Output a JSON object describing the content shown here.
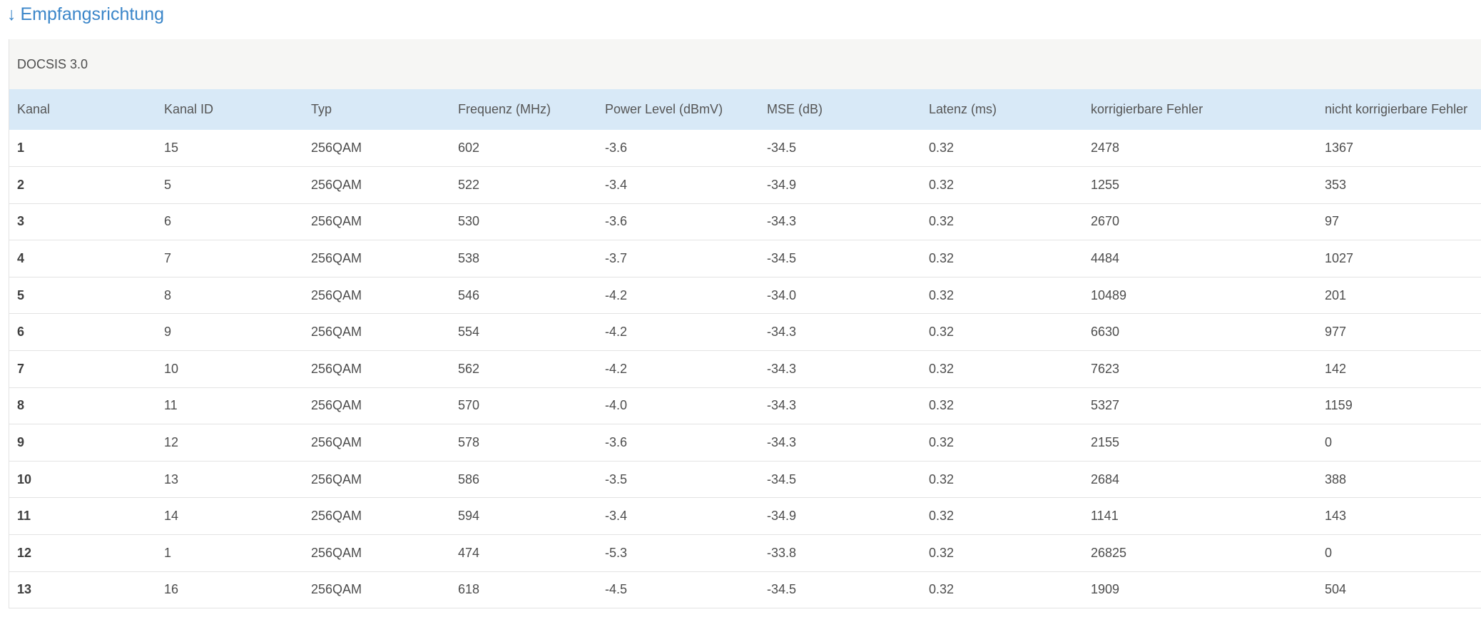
{
  "heading": {
    "arrow": "↓",
    "label": "Empfangsrichtung"
  },
  "panel": {
    "title": "DOCSIS 3.0"
  },
  "table": {
    "columns": [
      "Kanal",
      "Kanal ID",
      "Typ",
      "Frequenz (MHz)",
      "Power Level (dBmV)",
      "MSE (dB)",
      "Latenz (ms)",
      "korrigierbare Fehler",
      "nicht korrigierbare Fehler"
    ],
    "rows": [
      [
        "1",
        "15",
        "256QAM",
        "602",
        "-3.6",
        "-34.5",
        "0.32",
        "2478",
        "1367"
      ],
      [
        "2",
        "5",
        "256QAM",
        "522",
        "-3.4",
        "-34.9",
        "0.32",
        "1255",
        "353"
      ],
      [
        "3",
        "6",
        "256QAM",
        "530",
        "-3.6",
        "-34.3",
        "0.32",
        "2670",
        "97"
      ],
      [
        "4",
        "7",
        "256QAM",
        "538",
        "-3.7",
        "-34.5",
        "0.32",
        "4484",
        "1027"
      ],
      [
        "5",
        "8",
        "256QAM",
        "546",
        "-4.2",
        "-34.0",
        "0.32",
        "10489",
        "201"
      ],
      [
        "6",
        "9",
        "256QAM",
        "554",
        "-4.2",
        "-34.3",
        "0.32",
        "6630",
        "977"
      ],
      [
        "7",
        "10",
        "256QAM",
        "562",
        "-4.2",
        "-34.3",
        "0.32",
        "7623",
        "142"
      ],
      [
        "8",
        "11",
        "256QAM",
        "570",
        "-4.0",
        "-34.3",
        "0.32",
        "5327",
        "1159"
      ],
      [
        "9",
        "12",
        "256QAM",
        "578",
        "-3.6",
        "-34.3",
        "0.32",
        "2155",
        "0"
      ],
      [
        "10",
        "13",
        "256QAM",
        "586",
        "-3.5",
        "-34.5",
        "0.32",
        "2684",
        "388"
      ],
      [
        "11",
        "14",
        "256QAM",
        "594",
        "-3.4",
        "-34.9",
        "0.32",
        "1141",
        "143"
      ],
      [
        "12",
        "1",
        "256QAM",
        "474",
        "-5.3",
        "-33.8",
        "0.32",
        "26825",
        "0"
      ],
      [
        "13",
        "16",
        "256QAM",
        "618",
        "-4.5",
        "-34.5",
        "0.32",
        "1909",
        "504"
      ]
    ]
  },
  "colors": {
    "accent": "#3b86c9",
    "header_bg": "#d8e9f7",
    "panel_title_bg": "#f6f6f4"
  }
}
